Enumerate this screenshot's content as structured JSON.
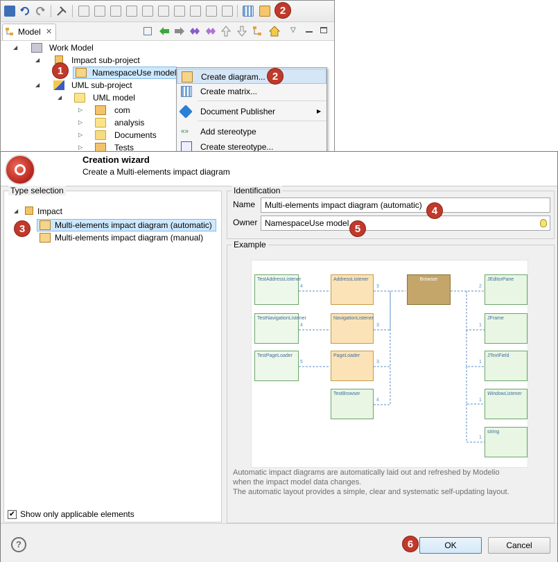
{
  "top_window": {
    "toolbar_icons": [
      "save-icon",
      "undo-icon",
      "redo-icon",
      "tools-icon",
      "diagram-a-icon",
      "diagram-b-icon",
      "diagram-c-icon",
      "diagram-d-icon",
      "diagram-e-icon",
      "diagram-f-icon",
      "diagram-g-icon",
      "diagram-h-icon",
      "diagram-i-icon",
      "matrix-icon",
      "impact-diagram-icon"
    ],
    "tab": {
      "label": "Model",
      "close": "✕"
    },
    "view_toolbar_icons": [
      "collapse-icon",
      "back-arrow-icon",
      "forward-arrow-icon",
      "link-icon",
      "sync-icon",
      "up-icon",
      "down-icon",
      "filter-icon",
      "home-icon",
      "menu-icon",
      "minimize-icon",
      "maximize-icon"
    ],
    "tree": [
      {
        "label": "Work Model",
        "icon": "work-model-icon",
        "twisty": "◢"
      },
      {
        "label": "Impact sub-project",
        "icon": "impact-project-icon",
        "twisty": "◢"
      },
      {
        "label": "NamespaceUse model",
        "icon": "namespace-model-icon",
        "twisty": "",
        "selected": true
      },
      {
        "label": "UML sub-project",
        "icon": "uml-project-icon",
        "twisty": "◢"
      },
      {
        "label": "UML model",
        "icon": "folder-icon",
        "twisty": "◢"
      },
      {
        "label": "com",
        "icon": "package-icon",
        "twisty": "▷"
      },
      {
        "label": "analysis",
        "icon": "folder-icon",
        "twisty": "▷"
      },
      {
        "label": "Documents",
        "icon": "folder-open-icon",
        "twisty": "▷"
      },
      {
        "label": "Tests",
        "icon": "package-icon",
        "twisty": "▷"
      }
    ],
    "context_menu": [
      {
        "label": "Create diagram...",
        "icon": "create-diagram-icon",
        "highlighted": true
      },
      {
        "label": "Create matrix...",
        "icon": "matrix-icon"
      },
      {
        "label": "Document Publisher",
        "icon": "document-publisher-icon",
        "submenu": "▶"
      },
      {
        "label": "Add stereotype",
        "icon": "add-stereotype-icon"
      },
      {
        "label": "Create stereotype...",
        "icon": "create-stereotype-icon"
      }
    ]
  },
  "badges": [
    "1",
    "2",
    "3",
    "4",
    "5",
    "6"
  ],
  "wizard": {
    "title": "Creation wizard",
    "subtitle": "Create a Multi-elements impact diagram",
    "type_selection": {
      "title": "Type selection",
      "root": "Impact",
      "items": [
        "Multi-elements impact diagram (automatic)",
        "Multi-elements impact diagram (manual)"
      ],
      "selected_index": 0
    },
    "show_only_applicable": {
      "label": "Show only applicable elements",
      "checked": true
    },
    "identification": {
      "title": "Identification",
      "name_label": "Name",
      "name_value": "Multi-elements impact diagram (automatic)",
      "owner_label": "Owner",
      "owner_value": "NamespaceUse model"
    },
    "example": {
      "title": "Example",
      "description_1": "Automatic impact diagrams are automatically laid out and refreshed by Modelio",
      "description_2": "when the impact model data changes.",
      "description_3": "The automatic layout provides a simple, clear and systematic self-updating layout.",
      "diagram": {
        "left": [
          "TestAddressListener",
          "TestNavigationListener",
          "TestPageLoader"
        ],
        "middle": [
          "AddressListener",
          "NavigationListener",
          "PageLoader",
          "TestBrowser"
        ],
        "center": "Browser",
        "right": [
          "JEditorPane",
          "JFrame",
          "JTextField",
          "WindowListener",
          "string"
        ],
        "left_counts": [
          "4",
          "4",
          "5"
        ],
        "middle_counts": [
          "3",
          "3",
          "3",
          "4"
        ],
        "right_counts": [
          "2",
          "1",
          "1",
          "1",
          "1"
        ]
      }
    },
    "ok_label": "OK",
    "cancel_label": "Cancel",
    "help_label": "?"
  },
  "colors": {
    "badge": "#c0392b",
    "selection": "#cde8ff",
    "menu_highlight": "#d5e6f6"
  }
}
